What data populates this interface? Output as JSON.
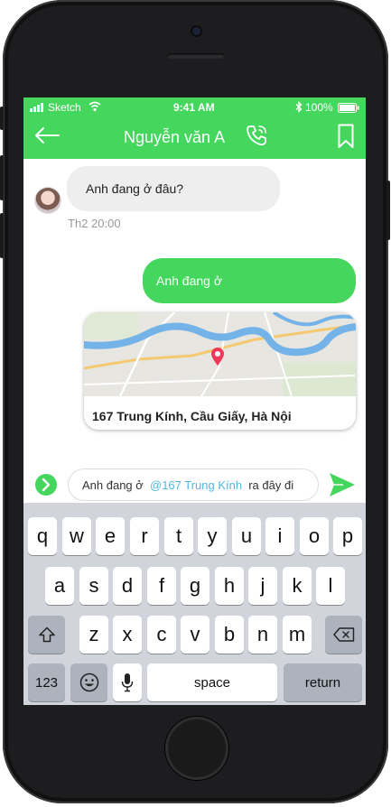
{
  "status": {
    "carrier": "Sketch",
    "time": "9:41 AM",
    "battery": "100%"
  },
  "header": {
    "contact_name": "Nguyễn văn A"
  },
  "messages": {
    "incoming": {
      "text": "Anh đang ở đâu?",
      "timestamp": "Th2 20:00"
    },
    "outgoing": {
      "text": "Anh đang ở"
    },
    "location": {
      "address": "167 Trung Kính, Cầu Giấy, Hà Nội"
    }
  },
  "composer": {
    "text_before": "Anh đang ở ",
    "mention": "@167 Trung Kính",
    "text_after": "  ra đây đi"
  },
  "keyboard": {
    "row1": [
      "q",
      "w",
      "e",
      "r",
      "t",
      "y",
      "u",
      "i",
      "o",
      "p"
    ],
    "row2": [
      "a",
      "s",
      "d",
      "f",
      "g",
      "h",
      "j",
      "k",
      "l"
    ],
    "row3": [
      "z",
      "x",
      "c",
      "v",
      "b",
      "n",
      "m"
    ],
    "numbers_label": "123",
    "space_label": "space",
    "return_label": "return"
  },
  "colors": {
    "accent": "#45d65e",
    "mention": "#4fb8e8",
    "pin": "#f0395a"
  }
}
